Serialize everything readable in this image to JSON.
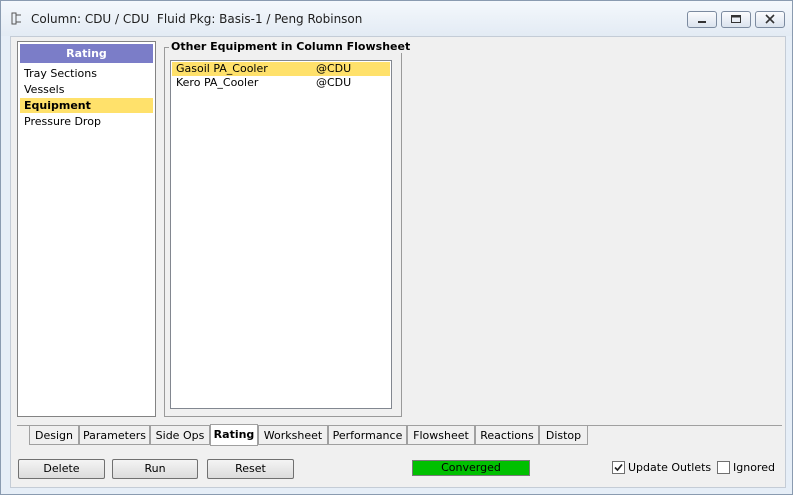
{
  "window": {
    "title": "Column: CDU / CDU  Fluid Pkg: Basis-1 / Peng Robinson",
    "controls": [
      "minimize-icon",
      "maximize-icon",
      "close-icon"
    ]
  },
  "sidebar": {
    "header": "Rating",
    "items": [
      {
        "label": "Tray Sections",
        "selected": false
      },
      {
        "label": "Vessels",
        "selected": false
      },
      {
        "label": "Equipment",
        "selected": true
      },
      {
        "label": "Pressure Drop",
        "selected": false
      }
    ]
  },
  "equipment_group": {
    "title": "Other Equipment in Column Flowsheet",
    "rows": [
      {
        "name": "Gasoil PA_Cooler",
        "location": "@CDU",
        "selected": true
      },
      {
        "name": "Kero PA_Cooler",
        "location": "@CDU",
        "selected": false
      }
    ]
  },
  "tabs": [
    {
      "label": "Design",
      "active": false
    },
    {
      "label": "Parameters",
      "active": false
    },
    {
      "label": "Side Ops",
      "active": false
    },
    {
      "label": "Rating",
      "active": true
    },
    {
      "label": "Worksheet",
      "active": false
    },
    {
      "label": "Performance",
      "active": false
    },
    {
      "label": "Flowsheet",
      "active": false
    },
    {
      "label": "Reactions",
      "active": false
    },
    {
      "label": "Distop",
      "active": false
    }
  ],
  "footer": {
    "delete_label": "Delete",
    "run_label": "Run",
    "reset_label": "Reset",
    "status_text": "Converged",
    "status_color": "#00c000",
    "update_outlets_label": "Update Outlets",
    "update_outlets_checked": true,
    "ignored_label": "Ignored",
    "ignored_checked": false
  },
  "colors": {
    "sidebar_header": "#7b7dc8",
    "selection": "#ffe16b"
  }
}
